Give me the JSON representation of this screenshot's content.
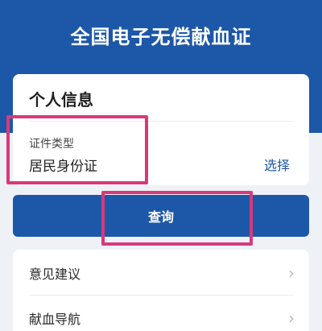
{
  "header": {
    "title": "全国电子无偿献血证"
  },
  "personal_info": {
    "title": "个人信息",
    "id_type_label": "证件类型",
    "id_type_value": "居民身份证",
    "select_label": "选择"
  },
  "query_button": {
    "label": "查询"
  },
  "menu": {
    "items": [
      {
        "label": "意见建议",
        "icon": "chevron-right-icon"
      },
      {
        "label": "献血导航",
        "icon": "chevron-right-icon"
      }
    ]
  },
  "colors": {
    "brand": "#1d57a8",
    "highlight": "#d8397a",
    "background": "#eef1f6"
  }
}
